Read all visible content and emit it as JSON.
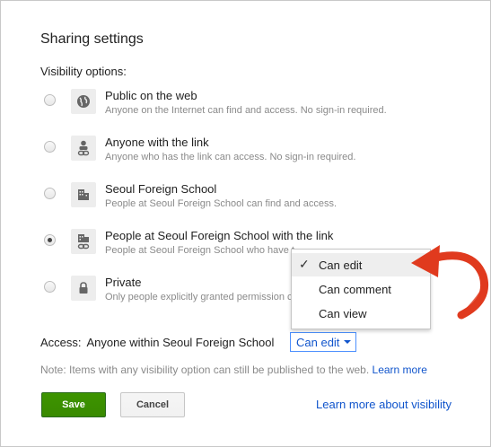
{
  "dialog": {
    "title": "Sharing settings",
    "visibility_label": "Visibility options:"
  },
  "options": [
    {
      "title": "Public on the web",
      "desc": "Anyone on the Internet can find and access. No sign-in required.",
      "icon": "globe-icon",
      "checked": false
    },
    {
      "title": "Anyone with the link",
      "desc": "Anyone who has the link can access. No sign-in required.",
      "icon": "person-link-icon",
      "checked": false
    },
    {
      "title": "Seoul Foreign School",
      "desc": "People at Seoul Foreign School can find and access.",
      "icon": "building-icon",
      "checked": false
    },
    {
      "title": "People at Seoul Foreign School with the link",
      "desc": "People at Seoul Foreign School who have t",
      "icon": "building-link-icon",
      "checked": true
    },
    {
      "title": "Private",
      "desc": "Only people explicitly granted permission c",
      "icon": "lock-icon",
      "checked": false
    }
  ],
  "access": {
    "label": "Access:",
    "value": "Anyone within Seoul Foreign School",
    "dropdown_label": "Can edit"
  },
  "menu": {
    "items": [
      {
        "label": "Can edit",
        "selected": true
      },
      {
        "label": "Can comment",
        "selected": false
      },
      {
        "label": "Can view",
        "selected": false
      }
    ]
  },
  "note": {
    "text": "Note: Items with any visibility option can still be published to the web.",
    "link": "Learn more"
  },
  "buttons": {
    "save": "Save",
    "cancel": "Cancel"
  },
  "learn_more_visibility": "Learn more about visibility",
  "colors": {
    "accent_link": "#1155cc",
    "save_green": "#3d9400",
    "arrow_red": "#e03a1e"
  }
}
